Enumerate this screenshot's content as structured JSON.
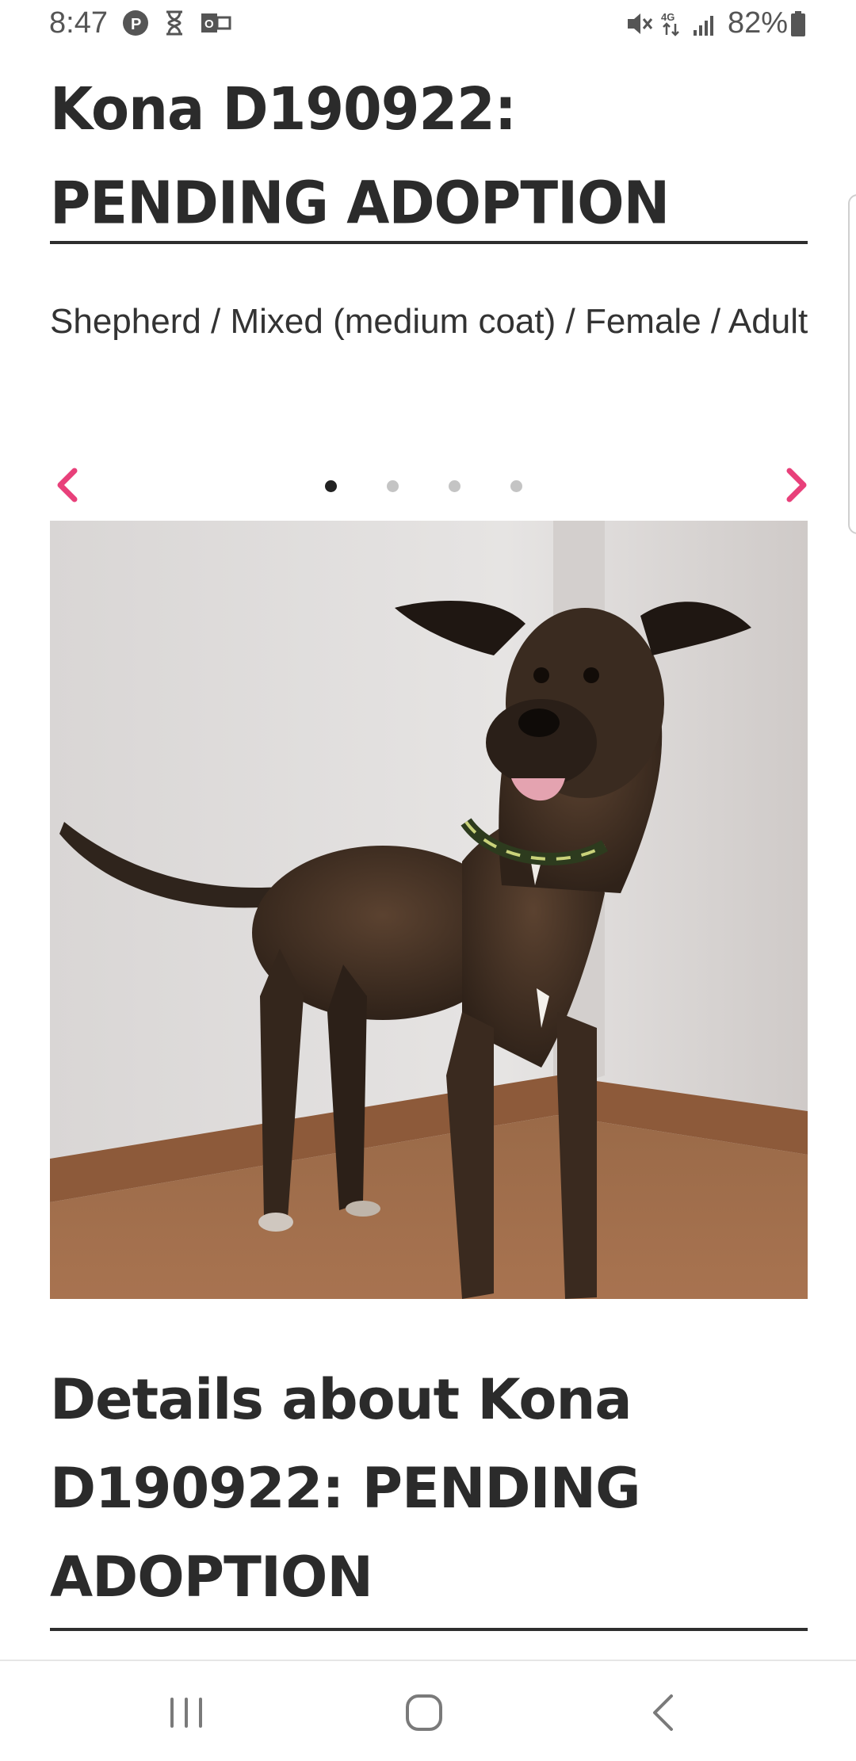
{
  "status_bar": {
    "time": "8:47",
    "battery": "82%",
    "left_icons": [
      "p-icon",
      "hourglass-icon",
      "outlook-icon"
    ],
    "right_icons": [
      "mute-icon",
      "data-4g-icon",
      "signal-icon",
      "battery-icon"
    ]
  },
  "title": "Kona D190922: PENDING ADOPTION",
  "subtitle": "Shepherd / Mixed (medium coat) / Female / Adult",
  "carousel": {
    "dot_count": 4,
    "active_index": 0,
    "prev_icon": "chevron-left-icon",
    "next_icon": "chevron-right-icon",
    "image": "brindle-dog-photo"
  },
  "details_title": "Details about Kona D190922: PENDING ADOPTION",
  "colors": {
    "accent": "#e8407a",
    "text": "#2b2b2b"
  },
  "nav_bar": {
    "icons": [
      "recents-icon",
      "home-icon",
      "back-icon"
    ]
  }
}
